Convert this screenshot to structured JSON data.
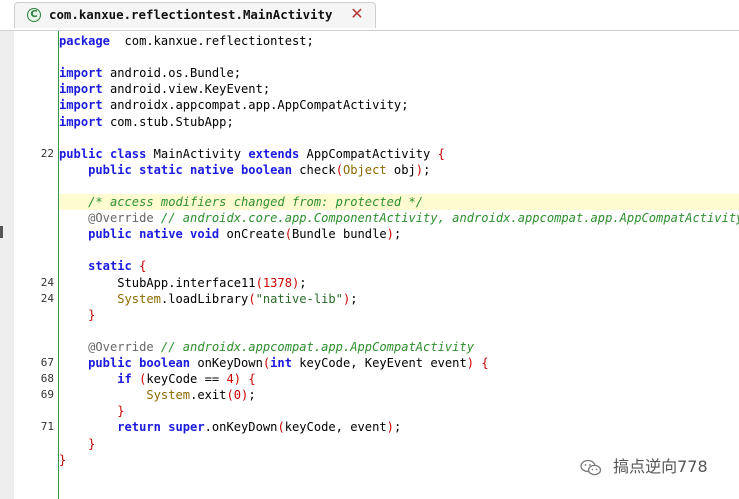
{
  "tab": {
    "title": "com.kanxue.reflectiontest.MainActivity",
    "icon": "class-icon"
  },
  "editor": {
    "lines": [
      {
        "ln": "",
        "segments": [
          [
            "kw",
            "package"
          ],
          [
            "",
            "  com.kanxue.reflectiontest;"
          ]
        ]
      },
      {
        "ln": "",
        "segments": []
      },
      {
        "ln": "",
        "segments": [
          [
            "kw",
            "import"
          ],
          [
            "",
            " android.os.Bundle;"
          ]
        ]
      },
      {
        "ln": "",
        "segments": [
          [
            "kw",
            "import"
          ],
          [
            "",
            " android.view.KeyEvent;"
          ]
        ]
      },
      {
        "ln": "",
        "segments": [
          [
            "kw",
            "import"
          ],
          [
            "",
            " androidx.appcompat.app.AppCompatActivity;"
          ]
        ]
      },
      {
        "ln": "",
        "segments": [
          [
            "kw",
            "import"
          ],
          [
            "",
            " com.stub.StubApp;"
          ]
        ]
      },
      {
        "ln": "",
        "segments": []
      },
      {
        "ln": "22",
        "segments": [
          [
            "kw",
            "public class"
          ],
          [
            "",
            " MainActivity "
          ],
          [
            "kw",
            "extends"
          ],
          [
            "",
            " AppCompatActivity "
          ],
          [
            "sb",
            "{"
          ]
        ]
      },
      {
        "ln": "",
        "segments": [
          [
            "",
            "    "
          ],
          [
            "kw",
            "public static native boolean"
          ],
          [
            "",
            " check"
          ],
          [
            "sb",
            "("
          ],
          [
            "sy",
            "Object"
          ],
          [
            "",
            " obj"
          ],
          [
            "sb",
            ")"
          ],
          [
            "",
            ";"
          ]
        ]
      },
      {
        "ln": "",
        "segments": []
      },
      {
        "ln": "",
        "hl": true,
        "segments": [
          [
            "",
            "    "
          ],
          [
            "cm",
            "/* access modifiers changed from: protected */"
          ]
        ]
      },
      {
        "ln": "",
        "segments": [
          [
            "",
            "    "
          ],
          [
            "an",
            "@Override"
          ],
          [
            "cm",
            " // androidx.core.app.ComponentActivity, androidx.appcompat.app.AppCompatActivity"
          ]
        ]
      },
      {
        "ln": "",
        "segments": [
          [
            "",
            "    "
          ],
          [
            "kw",
            "public native void"
          ],
          [
            "",
            " onCreate"
          ],
          [
            "sb",
            "("
          ],
          [
            "",
            "Bundle bundle"
          ],
          [
            "sb",
            ")"
          ],
          [
            "",
            ";"
          ]
        ]
      },
      {
        "ln": "",
        "segments": []
      },
      {
        "ln": "",
        "segments": [
          [
            "",
            "    "
          ],
          [
            "kw",
            "static"
          ],
          [
            "",
            " "
          ],
          [
            "sb",
            "{"
          ]
        ]
      },
      {
        "ln": "24",
        "segments": [
          [
            "",
            "        StubApp.interface11"
          ],
          [
            "sb",
            "("
          ],
          [
            "nm",
            "1378"
          ],
          [
            "sb",
            ")"
          ],
          [
            "",
            ";"
          ]
        ]
      },
      {
        "ln": "24",
        "segments": [
          [
            "",
            "        "
          ],
          [
            "sy",
            "System"
          ],
          [
            "",
            ".loadLibrary"
          ],
          [
            "sb",
            "("
          ],
          [
            "st",
            "\"native-lib\""
          ],
          [
            "sb",
            ")"
          ],
          [
            "",
            ";"
          ]
        ]
      },
      {
        "ln": "",
        "segments": [
          [
            "",
            "    "
          ],
          [
            "sb",
            "}"
          ]
        ]
      },
      {
        "ln": "",
        "segments": []
      },
      {
        "ln": "",
        "segments": [
          [
            "",
            "    "
          ],
          [
            "an",
            "@Override"
          ],
          [
            "cm",
            " // androidx.appcompat.app.AppCompatActivity"
          ]
        ]
      },
      {
        "ln": "67",
        "segments": [
          [
            "",
            "    "
          ],
          [
            "kw",
            "public boolean"
          ],
          [
            "",
            " onKeyDown"
          ],
          [
            "sb",
            "("
          ],
          [
            "kw",
            "int"
          ],
          [
            "",
            " keyCode, KeyEvent event"
          ],
          [
            "sb",
            ")"
          ],
          [
            "",
            " "
          ],
          [
            "sb",
            "{"
          ]
        ]
      },
      {
        "ln": "68",
        "segments": [
          [
            "",
            "        "
          ],
          [
            "kw",
            "if"
          ],
          [
            "",
            " "
          ],
          [
            "sb",
            "("
          ],
          [
            "",
            "keyCode == "
          ],
          [
            "nm",
            "4"
          ],
          [
            "sb",
            ")"
          ],
          [
            "",
            " "
          ],
          [
            "sb",
            "{"
          ]
        ]
      },
      {
        "ln": "69",
        "segments": [
          [
            "",
            "            "
          ],
          [
            "sy",
            "System"
          ],
          [
            "",
            ".exit"
          ],
          [
            "sb",
            "("
          ],
          [
            "nm",
            "0"
          ],
          [
            "sb",
            ")"
          ],
          [
            "",
            ";"
          ]
        ]
      },
      {
        "ln": "",
        "segments": [
          [
            "",
            "        "
          ],
          [
            "sb",
            "}"
          ]
        ]
      },
      {
        "ln": "71",
        "segments": [
          [
            "",
            "        "
          ],
          [
            "kw",
            "return super"
          ],
          [
            "",
            ".onKeyDown"
          ],
          [
            "sb",
            "("
          ],
          [
            "",
            "keyCode, event"
          ],
          [
            "sb",
            ")"
          ],
          [
            "",
            ";"
          ]
        ]
      },
      {
        "ln": "",
        "segments": [
          [
            "",
            "    "
          ],
          [
            "sb",
            "}"
          ]
        ]
      },
      {
        "ln": "",
        "segments": [
          [
            "sb",
            "}"
          ]
        ]
      }
    ]
  },
  "watermark": {
    "text": "搞点逆向778",
    "icon": "wechat-icon"
  }
}
